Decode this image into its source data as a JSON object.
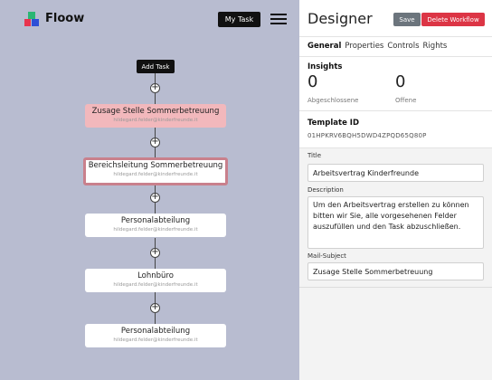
{
  "app": {
    "name": "Floow"
  },
  "topbar": {
    "my_task_label": "My Task"
  },
  "canvas": {
    "add_task_label": "Add Task",
    "plus_symbol": "+",
    "nodes": [
      {
        "title": "Zusage Stelle Sommerbetreuung",
        "email": "hildegard.felder@kinderfreunde.it",
        "state": "highlighted"
      },
      {
        "title": "Bereichsleitung Sommerbetreuung",
        "email": "hildegard.felder@kinderfreunde.it",
        "state": "selected"
      },
      {
        "title": "Personalabteilung",
        "email": "hildegard.felder@kinderfreunde.it",
        "state": "normal"
      },
      {
        "title": "Lohnbüro",
        "email": "hildegard.felder@kinderfreunde.it",
        "state": "normal"
      },
      {
        "title": "Personalabteilung",
        "email": "hildegard.felder@kinderfreunde.it",
        "state": "normal"
      }
    ]
  },
  "designer": {
    "title": "Designer",
    "save_label": "Save",
    "delete_label": "Delete Workflow",
    "tabs": [
      {
        "label": "General",
        "active": true
      },
      {
        "label": "Properties",
        "active": false
      },
      {
        "label": "Controls",
        "active": false
      },
      {
        "label": "Rights",
        "active": false
      }
    ],
    "insights": {
      "heading": "Insights",
      "completed_value": "0",
      "completed_label": "Abgeschlossene",
      "open_value": "0",
      "open_label": "Offene"
    },
    "template": {
      "heading": "Template ID",
      "id": "01HPKRV6BQH5DWD4ZPQD65Q80P"
    },
    "form": {
      "title_label": "Title",
      "title_value": "Arbeitsvertrag Kinderfreunde",
      "description_label": "Description",
      "description_value": "Um den Arbeitsvertrag erstellen zu können bitten wir Sie, alle vorgesehenen Felder auszufüllen und den Task abzuschließen.",
      "mail_subject_label": "Mail-Subject",
      "mail_subject_value": "Zusage Stelle Sommerbetreuung"
    }
  },
  "colors": {
    "canvas_bg": "#b8bcd0",
    "highlight_node": "#f2b8bc",
    "selected_border": "#c9808c",
    "delete_button": "#dc3545",
    "save_button": "#6c757d"
  }
}
